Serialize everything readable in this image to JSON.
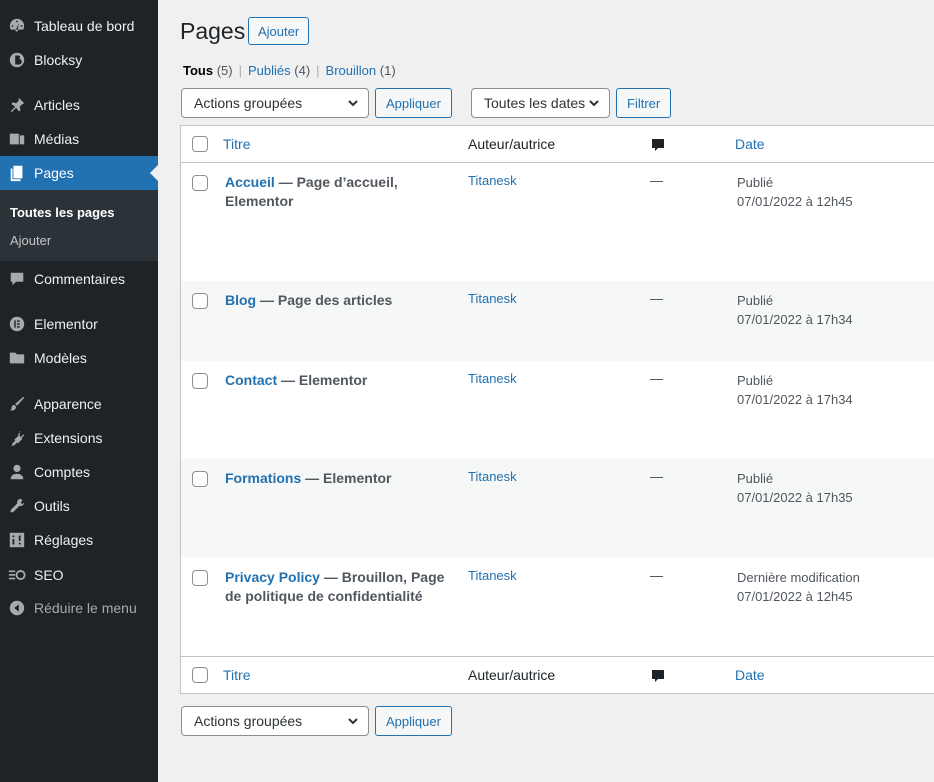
{
  "sidebar": {
    "items": [
      {
        "label": "Tableau de bord",
        "icon": "dashboard-icon"
      },
      {
        "label": "Blocksy",
        "icon": "blocksy-icon"
      },
      {
        "label": "Articles",
        "icon": "pin-icon"
      },
      {
        "label": "Médias",
        "icon": "media-icon"
      },
      {
        "label": "Pages",
        "icon": "pages-icon"
      },
      {
        "label": "Commentaires",
        "icon": "comments-icon"
      },
      {
        "label": "Elementor",
        "icon": "elementor-icon"
      },
      {
        "label": "Modèles",
        "icon": "folder-icon"
      },
      {
        "label": "Apparence",
        "icon": "brush-icon"
      },
      {
        "label": "Extensions",
        "icon": "plugin-icon"
      },
      {
        "label": "Comptes",
        "icon": "user-icon"
      },
      {
        "label": "Outils",
        "icon": "wrench-icon"
      },
      {
        "label": "Réglages",
        "icon": "settings-icon"
      },
      {
        "label": "SEO",
        "icon": "seo-icon"
      },
      {
        "label": "Réduire le menu",
        "icon": "collapse-icon"
      }
    ],
    "submenu": [
      "Toutes les pages",
      "Ajouter"
    ],
    "accent": "#2271b1"
  },
  "header": {
    "title": "Pages",
    "add_label": "Ajouter"
  },
  "filters": {
    "all_label": "Tous",
    "all_count": "(5)",
    "published_label": "Publiés",
    "published_count": "(4)",
    "draft_label": "Brouillon",
    "draft_count": "(1)",
    "separator": "|"
  },
  "toolbar": {
    "bulk_select": "Actions groupées",
    "apply_label": "Appliquer",
    "dates_select": "Toutes les dates",
    "filter_label": "Filtrer"
  },
  "table": {
    "columns": {
      "title": "Titre",
      "author": "Auteur/autrice",
      "comments": "comments-icon",
      "date": "Date"
    },
    "rows": [
      {
        "title": "Accueil",
        "state": " — Page d’accueil, Elementor",
        "author": "Titanesk",
        "comments": "—",
        "status": "Publié",
        "date": "07/01/2022 à 12h45"
      },
      {
        "title": "Blog",
        "state": " — Page des articles",
        "author": "Titanesk",
        "comments": "—",
        "status": "Publié",
        "date": "07/01/2022 à 17h34"
      },
      {
        "title": "Contact",
        "state": " — Elementor",
        "author": "Titanesk",
        "comments": "—",
        "status": "Publié",
        "date": "07/01/2022 à 17h34"
      },
      {
        "title": "Formations",
        "state": " — Elementor",
        "author": "Titanesk",
        "comments": "—",
        "status": "Publié",
        "date": "07/01/2022 à 17h35"
      },
      {
        "title": "Privacy Policy",
        "state": " — Brouillon, Page de politique de confidentialité",
        "author": "Titanesk",
        "comments": "—",
        "status": "Dernière modification",
        "date": "07/01/2022 à 12h45"
      }
    ]
  },
  "bottom_toolbar": {
    "bulk_select": "Actions groupées",
    "apply_label": "Appliquer"
  }
}
